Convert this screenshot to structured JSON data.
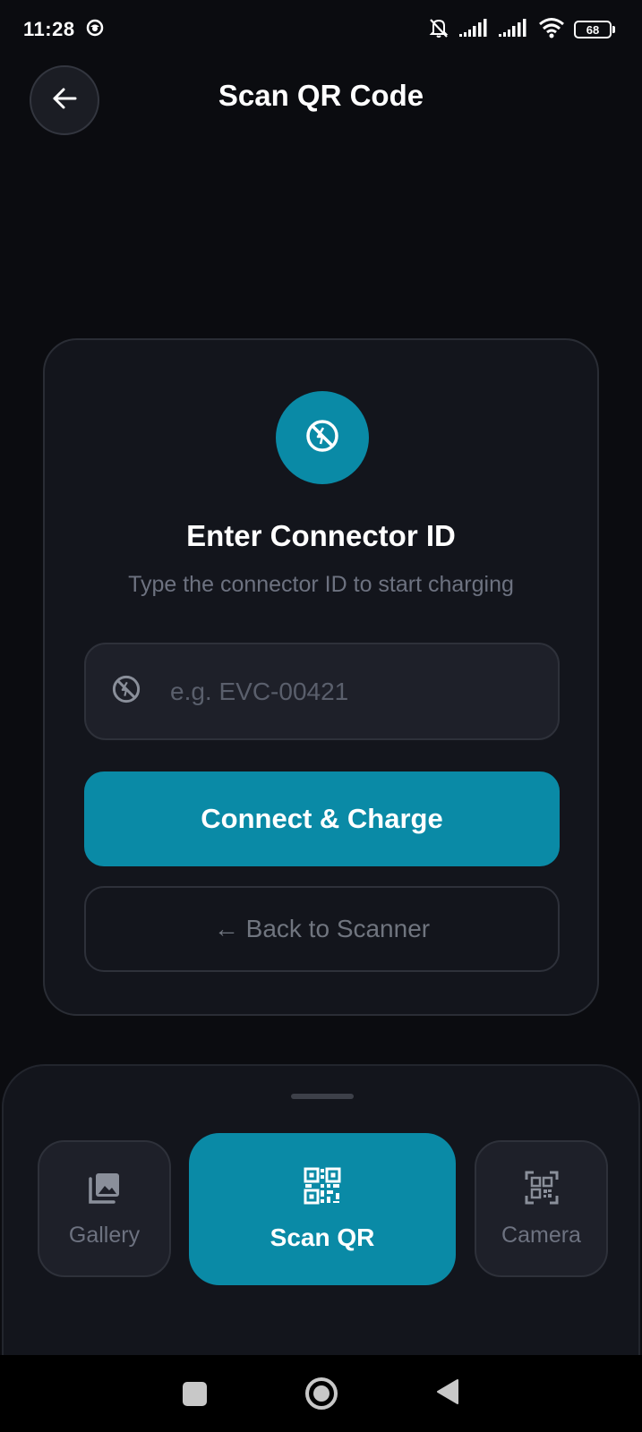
{
  "status_bar": {
    "time": "11:28",
    "battery": "68",
    "icons": [
      "notification-icon",
      "mute-icon",
      "signal-icon",
      "signal-icon",
      "wifi-icon",
      "battery-icon"
    ]
  },
  "header": {
    "title": "Scan QR Code",
    "back_icon": "arrow-left-icon"
  },
  "card": {
    "icon": "no-charging-icon",
    "title": "Enter Connector ID",
    "subtitle": "Type the connector ID to start charging",
    "input": {
      "placeholder": "e.g. EVC-00421",
      "value": ""
    },
    "primary_button": "Connect & Charge",
    "secondary_button": "← Back to Scanner"
  },
  "bottom_tabs": [
    {
      "label": "Gallery",
      "icon": "gallery-icon",
      "active": false
    },
    {
      "label": "Scan QR",
      "icon": "qr-code-icon",
      "active": true
    },
    {
      "label": "Camera",
      "icon": "qr-scan-icon",
      "active": false
    }
  ],
  "colors": {
    "accent": "#0a8aa6",
    "background": "#0b0c10",
    "card": "#13151c",
    "muted_text": "#6d7280"
  }
}
